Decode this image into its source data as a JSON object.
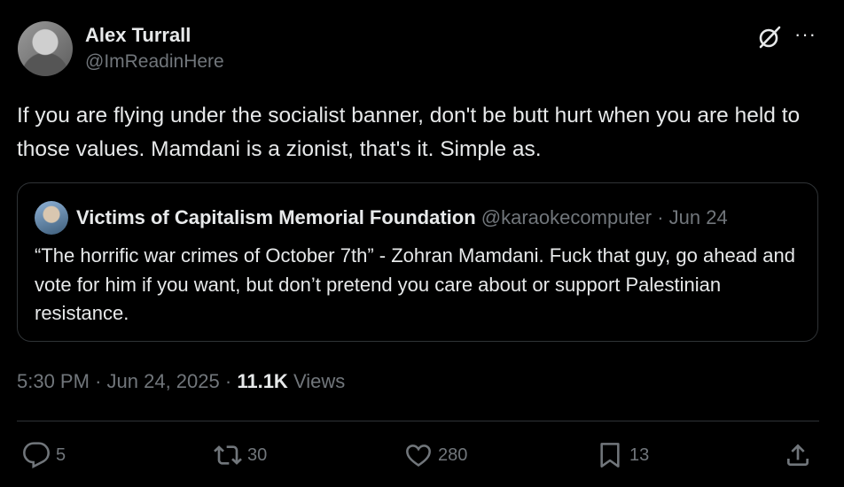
{
  "author": {
    "name": "Alex Turrall",
    "handle": "@ImReadinHere"
  },
  "icons": {
    "header": [
      "grok-icon",
      "more-icon"
    ],
    "more_glyph": "···"
  },
  "post": {
    "text": "If you are flying under the socialist banner, don't be butt hurt when you are held to those values. Mamdani is a zionist, that's it. Simple as."
  },
  "quote": {
    "name": "Victims of Capitalism Memorial Foundation",
    "handle": "@karaokecomputer",
    "separator": "·",
    "date": "Jun 24",
    "text": "“The horrific war crimes of October 7th” - Zohran Mamdani. Fuck that guy, go ahead and vote for him if you want, but don’t pretend you care about or support Palestinian resistance."
  },
  "meta": {
    "time": "5:30 PM",
    "sep1": "·",
    "date": "Jun 24, 2025",
    "sep2": "·",
    "views_count": "11.1K",
    "views_label": "Views"
  },
  "actions": {
    "replies": "5",
    "reposts": "30",
    "likes": "280",
    "bookmarks": "13"
  },
  "colors": {
    "background": "#000000",
    "text": "#e7e9ea",
    "muted": "#71767b",
    "border": "#2f3336"
  }
}
